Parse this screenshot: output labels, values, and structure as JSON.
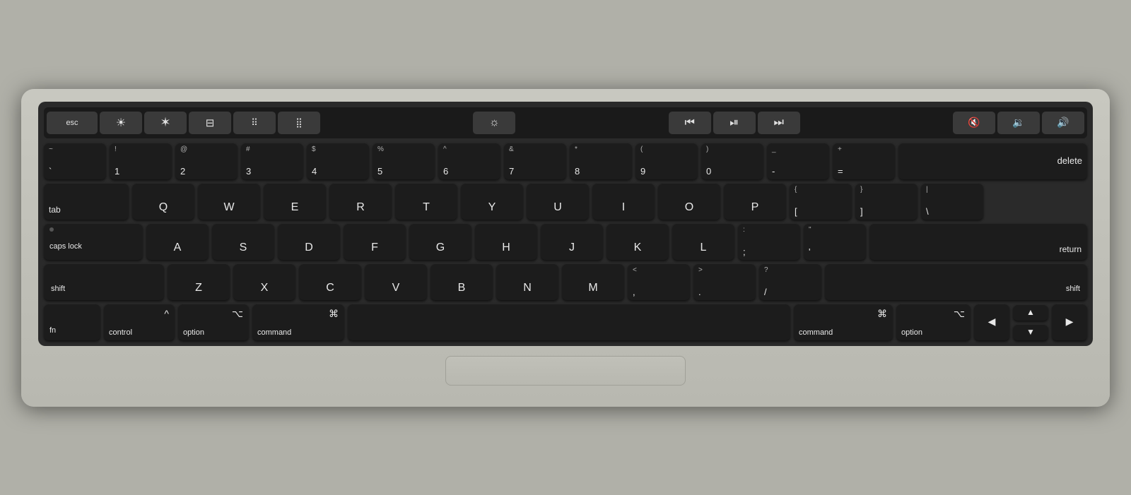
{
  "touchbar": {
    "keys": [
      {
        "id": "esc",
        "label": "esc",
        "type": "esc"
      },
      {
        "id": "brightness-down",
        "label": "☀",
        "type": "icon"
      },
      {
        "id": "brightness-up",
        "label": "✦",
        "type": "icon"
      },
      {
        "id": "mission-control",
        "label": "⊞",
        "type": "icon"
      },
      {
        "id": "launchpad",
        "label": "⠿",
        "type": "icon"
      },
      {
        "id": "keyboard-brightness-down",
        "label": "⠿",
        "type": "icon"
      },
      {
        "id": "display-brightness",
        "label": "☼",
        "type": "icon"
      },
      {
        "id": "rewind",
        "label": "◀◀",
        "type": "icon"
      },
      {
        "id": "play-pause",
        "label": "▶⏸",
        "type": "icon"
      },
      {
        "id": "fast-forward",
        "label": "▶▶",
        "type": "icon"
      },
      {
        "id": "mute",
        "label": "🔇",
        "type": "icon"
      },
      {
        "id": "volume-down",
        "label": "🔉",
        "type": "icon"
      },
      {
        "id": "volume-up",
        "label": "🔊",
        "type": "icon"
      }
    ]
  },
  "rows": {
    "row1": [
      {
        "id": "tilde",
        "top": "~",
        "main": "`",
        "label": "`"
      },
      {
        "id": "1",
        "top": "!",
        "main": "1"
      },
      {
        "id": "2",
        "top": "@",
        "main": "2"
      },
      {
        "id": "3",
        "top": "#",
        "main": "3"
      },
      {
        "id": "4",
        "top": "$",
        "main": "4"
      },
      {
        "id": "5",
        "top": "%",
        "main": "5"
      },
      {
        "id": "6",
        "top": "^",
        "main": "6"
      },
      {
        "id": "7",
        "top": "&",
        "main": "7"
      },
      {
        "id": "8",
        "top": "*",
        "main": "8"
      },
      {
        "id": "9",
        "top": "(",
        "main": "9"
      },
      {
        "id": "0",
        "top": ")",
        "main": "0"
      },
      {
        "id": "minus",
        "top": "_",
        "main": "-"
      },
      {
        "id": "equals",
        "top": "+",
        "main": "="
      },
      {
        "id": "delete",
        "label": "delete"
      }
    ],
    "row2": [
      {
        "id": "tab",
        "label": "tab"
      },
      {
        "id": "q",
        "letter": "Q"
      },
      {
        "id": "w",
        "letter": "W"
      },
      {
        "id": "e",
        "letter": "E"
      },
      {
        "id": "r",
        "letter": "R"
      },
      {
        "id": "t",
        "letter": "T"
      },
      {
        "id": "y",
        "letter": "Y"
      },
      {
        "id": "u",
        "letter": "U"
      },
      {
        "id": "i",
        "letter": "I"
      },
      {
        "id": "o",
        "letter": "O"
      },
      {
        "id": "p",
        "letter": "P"
      },
      {
        "id": "open-bracket",
        "top": "{",
        "main": "["
      },
      {
        "id": "close-bracket",
        "top": "}",
        "main": "]"
      },
      {
        "id": "backslash",
        "top": "|",
        "main": "\\"
      }
    ],
    "row3": [
      {
        "id": "caps-lock",
        "label": "caps lock"
      },
      {
        "id": "a",
        "letter": "A"
      },
      {
        "id": "s",
        "letter": "S"
      },
      {
        "id": "d",
        "letter": "D"
      },
      {
        "id": "f",
        "letter": "F"
      },
      {
        "id": "g",
        "letter": "G"
      },
      {
        "id": "h",
        "letter": "H"
      },
      {
        "id": "j",
        "letter": "J"
      },
      {
        "id": "k",
        "letter": "K"
      },
      {
        "id": "l",
        "letter": "L"
      },
      {
        "id": "semicolon",
        "top": ":",
        "main": ";"
      },
      {
        "id": "quote",
        "top": "\"",
        "main": "'"
      },
      {
        "id": "return",
        "label": "return"
      }
    ],
    "row4": [
      {
        "id": "shift-left",
        "label": "shift"
      },
      {
        "id": "z",
        "letter": "Z"
      },
      {
        "id": "x",
        "letter": "X"
      },
      {
        "id": "c",
        "letter": "C"
      },
      {
        "id": "v",
        "letter": "V"
      },
      {
        "id": "b",
        "letter": "B"
      },
      {
        "id": "n",
        "letter": "N"
      },
      {
        "id": "m",
        "letter": "M"
      },
      {
        "id": "comma",
        "top": "<",
        "main": ","
      },
      {
        "id": "period",
        "top": ">",
        "main": "."
      },
      {
        "id": "slash",
        "top": "?",
        "main": "/"
      },
      {
        "id": "shift-right",
        "label": "shift"
      }
    ],
    "row5": [
      {
        "id": "fn",
        "label": "fn"
      },
      {
        "id": "control",
        "symbol": "^",
        "label": "control"
      },
      {
        "id": "option-left",
        "symbol": "⌥",
        "label": "option"
      },
      {
        "id": "command-left",
        "symbol": "⌘",
        "label": "command"
      },
      {
        "id": "spacebar",
        "label": ""
      },
      {
        "id": "command-right",
        "symbol": "⌘",
        "label": "command"
      },
      {
        "id": "option-right",
        "symbol": "⌥",
        "label": "option"
      },
      {
        "id": "arrow-left",
        "label": "◀"
      },
      {
        "id": "arrow-up",
        "label": "▲"
      },
      {
        "id": "arrow-down",
        "label": "▼"
      },
      {
        "id": "arrow-right",
        "label": "▶"
      }
    ]
  }
}
